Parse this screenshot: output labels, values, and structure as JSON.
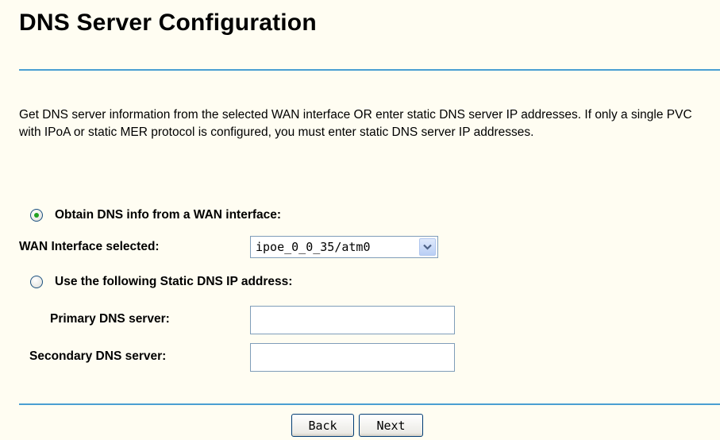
{
  "page": {
    "title": "DNS Server Configuration",
    "description": "Get DNS server information from the selected WAN interface OR enter static DNS server IP addresses. If only a single PVC with IPoA or static MER protocol is configured, you must enter static DNS server IP addresses."
  },
  "options": {
    "obtain_label": "Obtain DNS info from a WAN interface:",
    "obtain_selected": true,
    "static_label": "Use the following Static DNS IP address:",
    "static_selected": false
  },
  "wan": {
    "label": "WAN Interface selected:",
    "selected_value": "ipoe_0_0_35/atm0"
  },
  "static_dns": {
    "primary_label": "Primary DNS server:",
    "primary_value": "",
    "secondary_label": "Secondary DNS server:",
    "secondary_value": ""
  },
  "buttons": {
    "back_label": "Back",
    "next_label": "Next"
  },
  "colors": {
    "background": "#fffdf2",
    "rule": "#4a9fd2",
    "radio_dot": "#21a121"
  },
  "icons": {
    "radio_selected": "radio-selected-icon",
    "radio_unselected": "radio-unselected-icon",
    "dropdown": "chevron-down-icon"
  }
}
